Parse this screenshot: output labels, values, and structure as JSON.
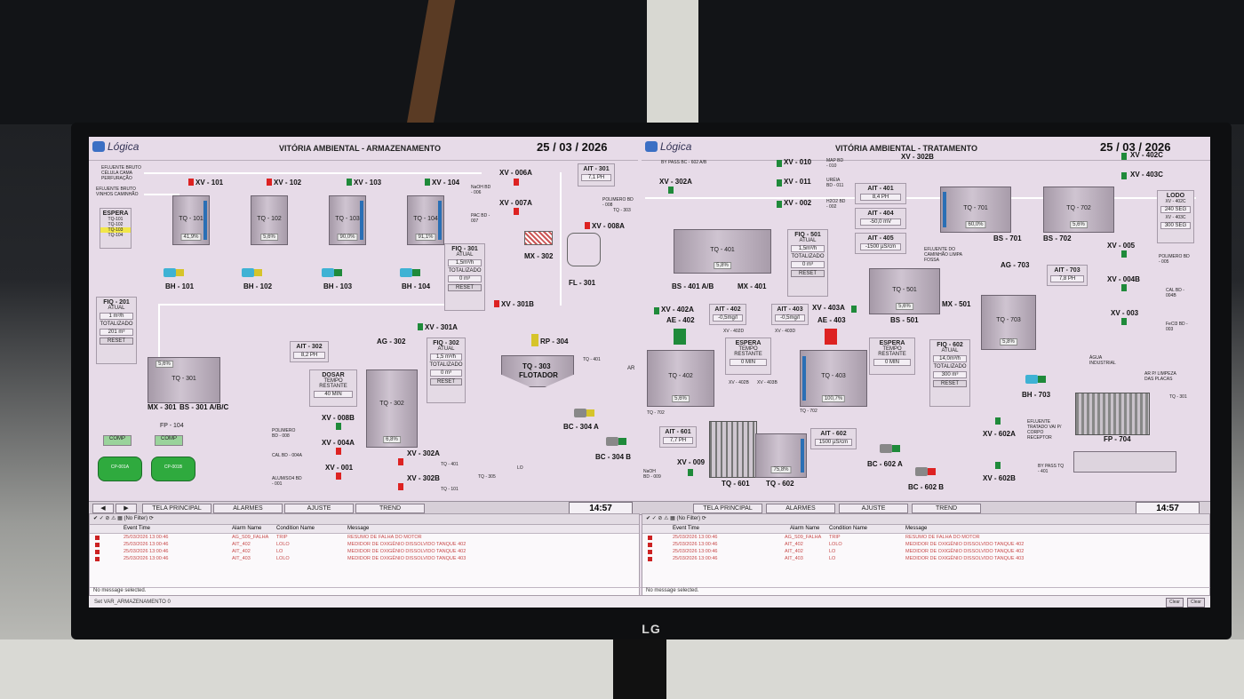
{
  "monitor": {
    "brand": "LG"
  },
  "left": {
    "logo": "Lógica",
    "title": "VITÓRIA AMBIENTAL - ARMAZENAMENTO",
    "date": "25 / 03 / 2026",
    "inputs": [
      "EFLUENTE BRUTO CÉLULA CAMA PERFURAÇÃO",
      "EFLUENTE BRUTO VINHOS CAMINHÃO"
    ],
    "espera": {
      "title": "ESPERA",
      "items": [
        "TQ-101",
        "TQ-102",
        "TQ-103",
        "TQ-104"
      ]
    },
    "valves": [
      "XV - 101",
      "XV - 102",
      "XV - 103",
      "XV - 104",
      "XV - 006A",
      "XV - 007A",
      "XV - 008A",
      "XV - 301A",
      "XV - 301B",
      "XV - 008B",
      "XV - 004A",
      "XV - 001",
      "XV - 302A",
      "XV - 302B"
    ],
    "tanks": [
      {
        "name": "TQ - 101",
        "value": "41,9%"
      },
      {
        "name": "TQ - 102",
        "value": "5,6%"
      },
      {
        "name": "TQ - 103",
        "value": "90,0%"
      },
      {
        "name": "TQ - 104",
        "value": "91,1%"
      }
    ],
    "pumps": [
      "BH - 101",
      "BH - 102",
      "BH - 103",
      "BH - 104"
    ],
    "chem": {
      "naoh": "NaOH BD - 006",
      "pac": "PAC BD - 007",
      "polimero": "POLIMERO BD - 008",
      "tq303": "TQ - 303"
    },
    "ait301": {
      "tag": "AIT - 301",
      "value": "7,1",
      "unit": "PH"
    },
    "mx302": "MX - 302",
    "fl301": "FL - 301",
    "fiq301": {
      "tag": "FIQ - 301",
      "atual": "ATUAL",
      "flow": "1,5m³/h",
      "totalizado": "TOTALIZADO",
      "total": "0",
      "unit": "m³",
      "reset": "RESET"
    },
    "fiq201": {
      "tag": "FIQ - 201",
      "atual": "ATUAL",
      "flow": "1 m³/h",
      "totalizado": "TOTALIZADO",
      "total": "201",
      "unit": "m³",
      "reset": "RESET"
    },
    "tq301": {
      "name": "TQ - 301",
      "value": "5,6%"
    },
    "mx301": "MX - 301",
    "bs301": "BS - 301 A/B/C",
    "fp104": "FP - 104",
    "ait302": {
      "tag": "AIT - 302",
      "value": "8,2",
      "unit": "PH"
    },
    "ag302": "AG - 302",
    "tq302": {
      "name": "TQ - 302",
      "value": "6,8%"
    },
    "dosar": {
      "title": "DOSAR",
      "sub": "TEMPO RESTANTE",
      "value": "40",
      "unit": "MIN"
    },
    "fiq302": {
      "tag": "FIQ - 302",
      "atual": "ATUAL",
      "flow": "1,5 m³/h",
      "totalizado": "TOTALIZADO",
      "total": "0",
      "unit": "m³",
      "reset": "RESET"
    },
    "rp304": "RP - 304",
    "tq303": {
      "name": "TQ - 303",
      "sub": "FLOTADOR"
    },
    "tq401": "TQ - 401",
    "ar": "AR",
    "bc304a": "BC - 304 A",
    "bc304b": "BC - 304 B",
    "lo": "LO",
    "tq305": "TQ - 305",
    "tq101b": "TQ - 101",
    "dosing": [
      "POLIMERO BD - 008",
      "CAL BD - 004A",
      "ALUM/SO4 BD - 001"
    ],
    "compressors": [
      {
        "name": "CP-001A",
        "label": "COMP"
      },
      {
        "name": "CP-001B",
        "label": "COMP"
      }
    ]
  },
  "right": {
    "logo": "Lógica",
    "title": "VITÓRIA AMBIENTAL - TRATAMENTO",
    "date": "25 / 03 / 2026",
    "bypass": "BY PASS BC - 602 A/B",
    "valves": [
      "XV - 302A",
      "XV - 010",
      "XV - 011",
      "XV - 002",
      "XV - 302B",
      "XV - 402C",
      "XV - 403C",
      "XV - 005",
      "XV - 004B",
      "XV - 003",
      "XV - 402A",
      "XV - 403A",
      "XV - 009",
      "XV - 602A",
      "XV - 602B"
    ],
    "chem": {
      "map": "MAP BD - 010",
      "ureia": "URÉIA BD - 011",
      "h2o2": "H2O2 BD - 002"
    },
    "ait401": {
      "tag": "AIT - 401",
      "value": "8,4",
      "unit": "PH"
    },
    "ait404": {
      "tag": "AIT - 404",
      "value": "-50,0",
      "unit": "mV"
    },
    "ait405": {
      "tag": "AIT - 405",
      "value": "-1500",
      "unit": "µS/cm"
    },
    "tq401": {
      "name": "TQ - 401",
      "value": "5,8%"
    },
    "bs401": "BS - 401 A/B",
    "mx401": "MX - 401",
    "fiq501": {
      "tag": "FIQ - 501",
      "atual": "ATUAL",
      "flow": "1,5m³/h",
      "totalizado": "TOTALIZADO",
      "total": "0",
      "unit": "m³",
      "reset": "RESET"
    },
    "caminhao": "EFLUENTE DO CAMINHÃO LIMPA FOSSA",
    "tq701": {
      "name": "TQ - 701",
      "value": "60,0%"
    },
    "tq702": {
      "name": "TQ - 702",
      "value": "5,6%"
    },
    "bs701": "BS - 701",
    "bs702": "BS - 702",
    "lodo": {
      "title": "LODO",
      "r1": "XV - 402C",
      "v1": "240",
      "u1": "SEG",
      "r2": "XV - 403C",
      "v2": "300",
      "u2": "SEG"
    },
    "tq501": {
      "name": "TQ - 501",
      "value": "5,6%"
    },
    "bs501": "BS - 501",
    "mx501": "MX - 501",
    "ag703": "AG - 703",
    "ait703": {
      "tag": "AIT - 703",
      "value": "7,8",
      "unit": "PH"
    },
    "tq703": {
      "name": "TQ - 703",
      "value": "5,8%"
    },
    "bh703": "BH - 703",
    "dosing": [
      "POLIMERO BD - 005",
      "CAL BD - 004B",
      "FeCl3 BD - 003"
    ],
    "agua": "ÁGUA INDUSTRIAL",
    "limpeza": "AR P/ LIMPEZA DAS PLACAS",
    "tq301r": "TQ - 301",
    "fp704": "FP - 704",
    "ae402": "AE - 402",
    "ae403": "AE - 403",
    "ait402": {
      "tag": "AIT - 402",
      "value": "-0,5mg/l"
    },
    "ait403": {
      "tag": "AIT - 403",
      "value": "-0,5mg/l"
    },
    "espera402": {
      "title": "ESPERA",
      "sub": "TEMPO RESTANTE",
      "value": "0",
      "unit": "MIN"
    },
    "espera403": {
      "title": "ESPERA",
      "sub": "TEMPO RESTANTE",
      "value": "0",
      "unit": "MIN"
    },
    "xv4020": "XV - 402D",
    "xv4030": "XV - 403D",
    "xv402b": "XV - 402B",
    "xv403b": "XV - 403B",
    "tq402": {
      "name": "TQ - 402",
      "value": "5,6%"
    },
    "tq403": {
      "name": "TQ - 403",
      "value": "100,7%"
    },
    "fiq602": {
      "tag": "FIQ - 602",
      "atual": "ATUAL",
      "flow": "14,0m³/h",
      "totalizado": "TOTALIZADO",
      "total": "300",
      "unit": "m³",
      "reset": "RESET"
    },
    "efluente": "EFLUENTE TRATADO VAI P/ CORPO RECEPTOR",
    "tq702b": "TQ - 702",
    "tq702c": "TQ - 702",
    "ait601": {
      "tag": "AIT - 601",
      "value": "7,7",
      "unit": "PH"
    },
    "ait602": {
      "tag": "AIT - 602",
      "value": "1500",
      "unit": "µS/cm"
    },
    "tq601": "TQ - 601",
    "tq602": {
      "name": "TQ - 602",
      "value": "75,8%"
    },
    "bc602a": "BC - 602 A",
    "bc602b": "BC - 602 B",
    "naoh": "NaOH BD - 009",
    "bypass2": "BY PASS TQ - 401"
  },
  "nav": {
    "left_tabs": [
      "TELA PRINCIPAL",
      "ALARMES",
      "AJUSTE",
      "TREND"
    ],
    "right_tabs": [
      "TELA PRINCIPAL",
      "ALARMES",
      "AJUSTE",
      "TREND"
    ],
    "time_left": "14:57",
    "time_right": "14:57"
  },
  "alarms": {
    "filter": "(No Filter)",
    "headers": [
      "Event Time",
      "Alarm Name",
      "Condition Name",
      "Message"
    ],
    "left_rows": [
      {
        "time": "25/03/2026 13:00:46",
        "name": "AG_S09_FALHA",
        "cond": "TRIP",
        "msg": "RESUMO DE FALHA DO MOTOR"
      },
      {
        "time": "25/03/2026 13:00:46",
        "name": "AIT_402",
        "cond": "LOLO",
        "msg": "MEDIDOR DE OXIGÊNIO DISSOLVIDO TANQUE 402"
      },
      {
        "time": "25/03/2026 13:00:46",
        "name": "AIT_402",
        "cond": "LO",
        "msg": "MEDIDOR DE OXIGÊNIO DISSOLVIDO TANQUE 402"
      },
      {
        "time": "25/03/2026 13:00:46",
        "name": "AIT_403",
        "cond": "LOLO",
        "msg": "MEDIDOR DE OXIGÊNIO DISSOLVIDO TANQUE 403"
      }
    ],
    "right_rows": [
      {
        "time": "25/03/2026 13:00:46",
        "name": "AG_S09_FALHA",
        "cond": "TRIP",
        "msg": "RESUMO DE FALHA DO MOTOR"
      },
      {
        "time": "25/03/2026 13:00:46",
        "name": "AIT_402",
        "cond": "LOLO",
        "msg": "MEDIDOR DE OXIGÊNIO DISSOLVIDO TANQUE 402"
      },
      {
        "time": "25/03/2026 13:00:46",
        "name": "AIT_402",
        "cond": "LO",
        "msg": "MEDIDOR DE OXIGÊNIO DISSOLVIDO TANQUE 402"
      },
      {
        "time": "25/03/2026 13:00:46",
        "name": "AIT_403",
        "cond": "LO",
        "msg": "MEDIDOR DE OXIGÊNIO DISSOLVIDO TANQUE 403"
      }
    ],
    "no_message": "No message selected."
  },
  "status": {
    "text": "Set VAR_ARMAZENAMENTO 0",
    "btn1": "Clear",
    "btn2": "Clear All"
  }
}
